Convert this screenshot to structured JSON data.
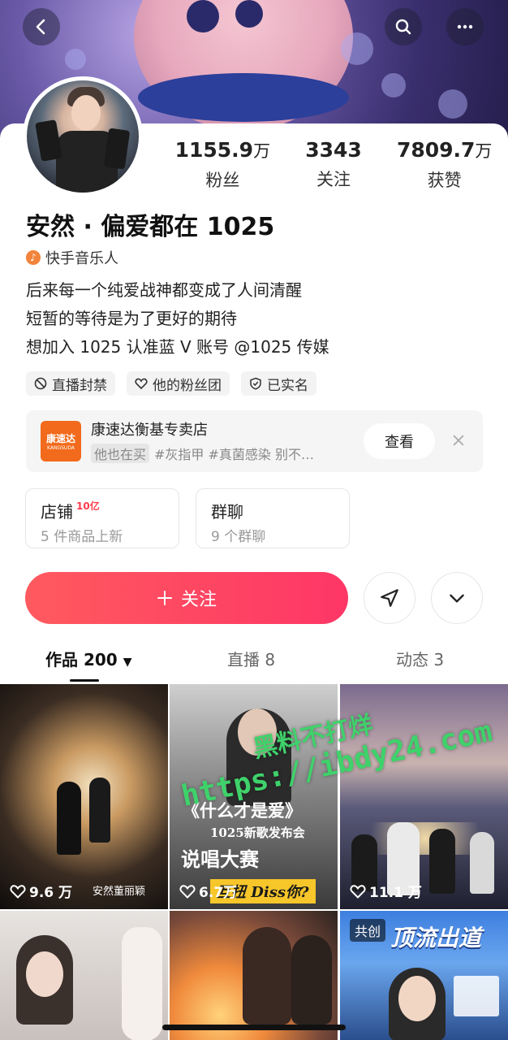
{
  "profile": {
    "name": "安然 · 偏爱都在 1025",
    "music_tag": "快手音乐人",
    "stats": [
      {
        "num": "1155.9",
        "unit": "万",
        "label": "粉丝"
      },
      {
        "num": "3343",
        "unit": "",
        "label": "关注"
      },
      {
        "num": "7809.7",
        "unit": "万",
        "label": "获赞"
      }
    ],
    "bio": [
      "后来每一个纯爱战神都变成了人间清醒",
      "短暂的等待是为了更好的期待",
      "想加入 1025 认准蓝 V 账号 @1025 传媒"
    ],
    "tags": [
      {
        "label": "直播封禁",
        "icon": "ban-icon"
      },
      {
        "label": "他的粉丝团",
        "icon": "heart-icon"
      },
      {
        "label": "已实名",
        "icon": "shield-check-icon"
      }
    ]
  },
  "shop_card": {
    "logo_text": "康速达",
    "logo_sub": "KANGSUDA",
    "title": "康速达衡基专卖店",
    "pill": "他也在买",
    "desc": "#灰指甲 #真菌感染 别不…",
    "view_label": "查看"
  },
  "boxes": {
    "store": {
      "title": "店铺",
      "badge": "10亿",
      "sub": "5 件商品上新"
    },
    "group": {
      "title": "群聊",
      "sub": "9 个群聊"
    }
  },
  "follow_label": "关注",
  "tabs": [
    {
      "label": "作品 200",
      "active": true
    },
    {
      "label": "直播 8",
      "active": false
    },
    {
      "label": "动态 3",
      "active": false
    }
  ],
  "grid": {
    "c1": {
      "likes": "9.6 万",
      "caption": "安然董丽颖"
    },
    "c2": {
      "likes": "6.7万",
      "line1": "《什么才是爱》",
      "line2": "1025新歌发布会",
      "line3": "说唱大赛",
      "line4": "互扭 Diss你?"
    },
    "c3": {
      "likes": "11.1 万"
    },
    "c6": {
      "badge": "共创",
      "title": "顶流出道"
    }
  },
  "watermark": {
    "line1": "黑料不打烊",
    "line2": "https://ibdy24.com"
  },
  "colors": {
    "accent": "#fe3666",
    "shop_orange": "#f26a1b"
  }
}
